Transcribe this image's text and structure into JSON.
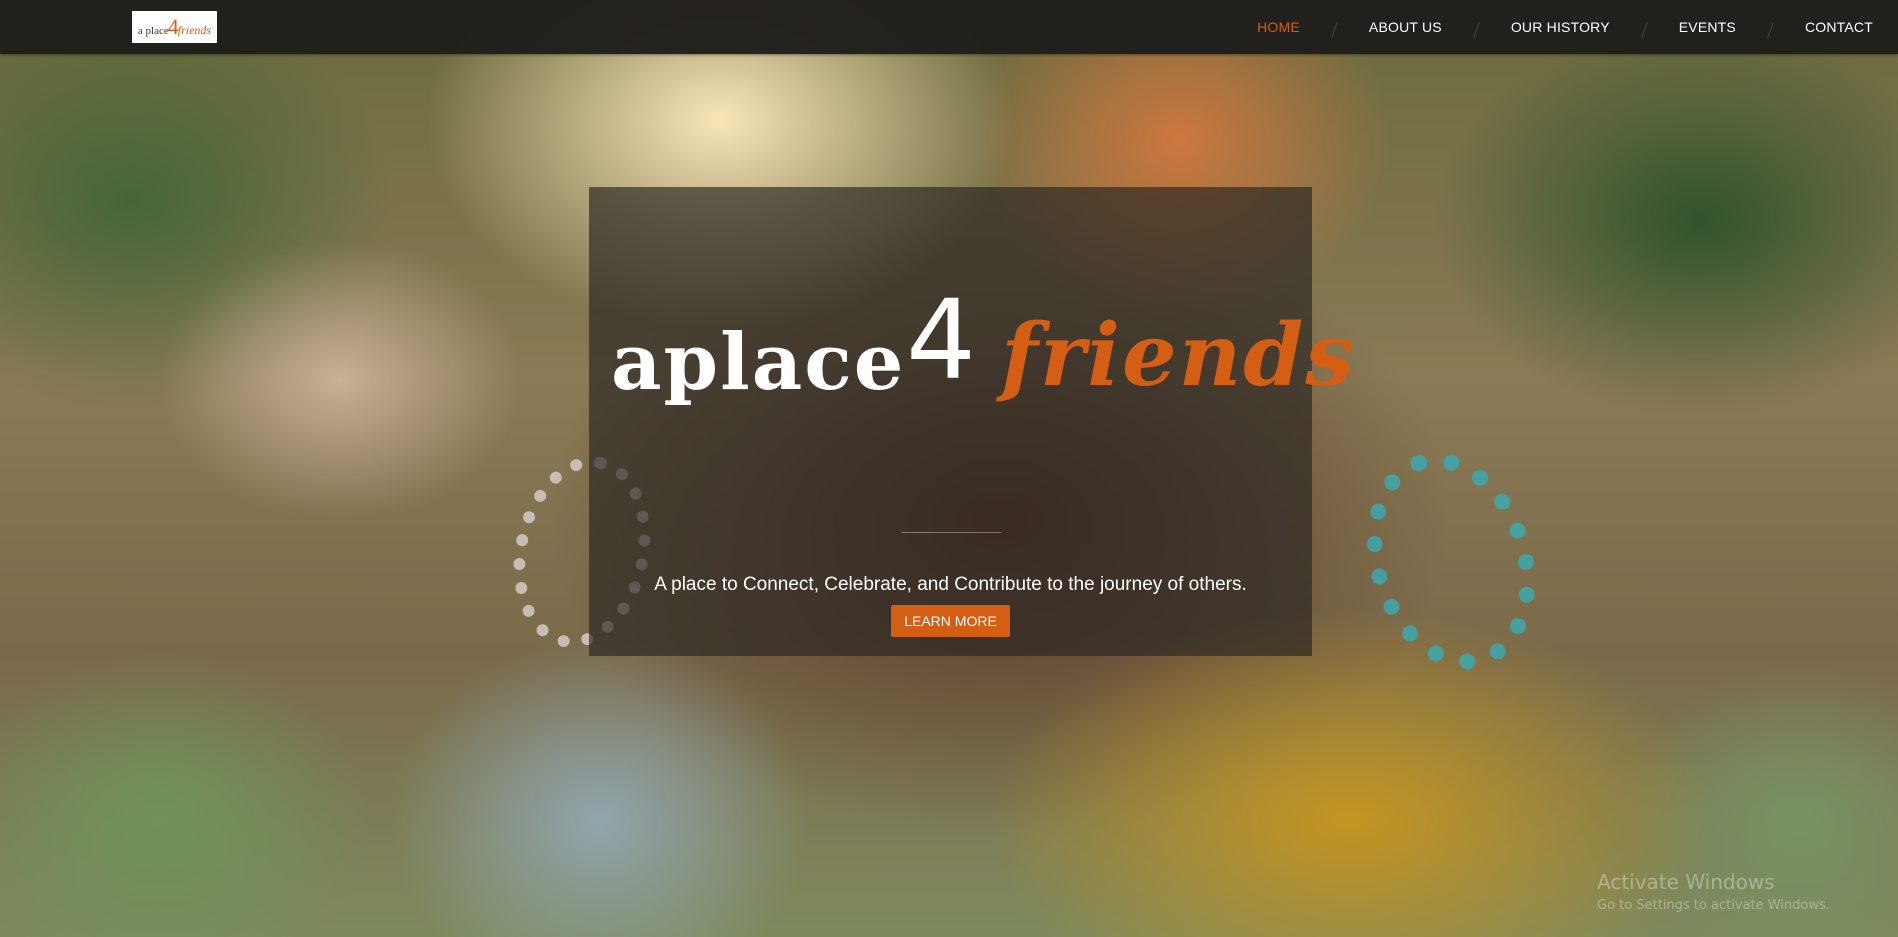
{
  "colors": {
    "accent": "#d35e14",
    "navbar_bg": "#1e1e1c",
    "card_overlay": "rgba(40,36,34,0.66)",
    "text_light": "#ffffff"
  },
  "navbar": {
    "logo": {
      "text_a": "a place",
      "text_4": "4",
      "text_friends": "friends"
    },
    "items": [
      {
        "label": "HOME",
        "active": true
      },
      {
        "label": "ABOUT US",
        "active": false
      },
      {
        "label": "OUR HISTORY",
        "active": false
      },
      {
        "label": "EVENTS",
        "active": false
      },
      {
        "label": "CONTACT",
        "active": false
      }
    ]
  },
  "hero": {
    "brand": {
      "aplace": "aplace",
      "four": "4",
      "friends": "friends"
    },
    "tagline": "A place to Connect, Celebrate, and Contribute to the journey of others.",
    "cta_label": "LEARN MORE"
  },
  "watermark": {
    "title": "Activate Windows",
    "subtitle": "Go to Settings to activate Windows."
  }
}
